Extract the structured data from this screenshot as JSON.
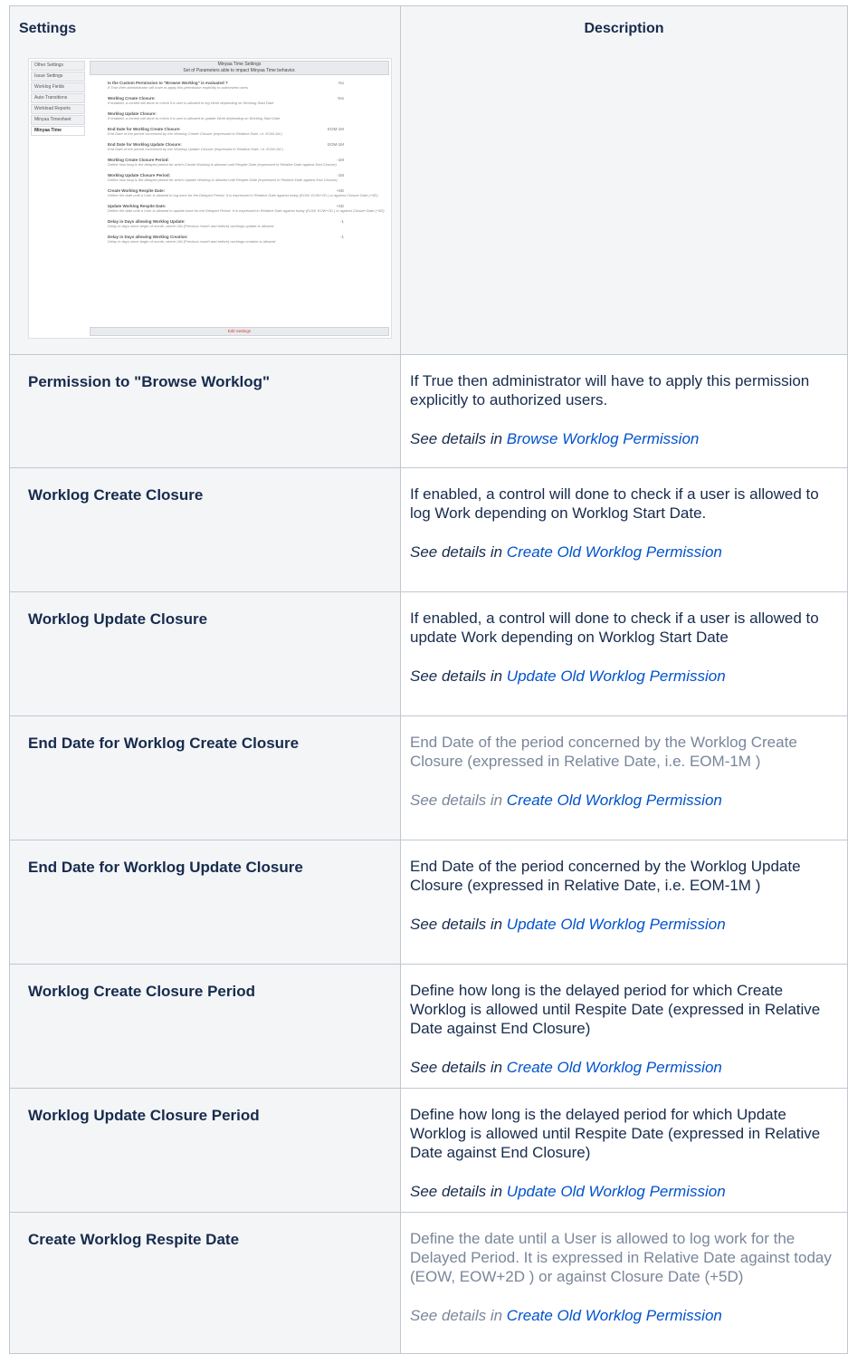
{
  "headers": {
    "settings": "Settings",
    "description": "Description"
  },
  "screenshot": {
    "sidebar": [
      "Other Settings",
      "Issue Settings",
      "Worklog Fields",
      "Auto-Transitions",
      "Workload Reports",
      "Minyaa Timesheet",
      "Minyaa Time"
    ],
    "active_index": 6,
    "title": "Minyaa Time Settings",
    "subtitle": "Set of Parameters able to impact Minyaa Time behavior.",
    "rows": [
      {
        "label": "Is the Custom Permission to \"Browse Worklog\" is evaluated ?",
        "hint": "If True then administrator will have to apply this permission explicitly to authorized users",
        "value": "No"
      },
      {
        "label": "Worklog Create Closure:",
        "hint": "If enabled, a control will done to check if a user is allowed to log Work depending on Worklog Start Date",
        "value": "Yes"
      },
      {
        "label": "Worklog Update Closure:",
        "hint": "If enabled, a control will done to check if a user is allowed to update Work depending on Worklog Start Date",
        "value": ""
      },
      {
        "label": "End Date for Worklog Create Closure:",
        "hint": "End Date of the period concerned by the Worklog Create Closure (expressed in Relative Date, i.e. EOM-1M )",
        "value": "EOM-1M"
      },
      {
        "label": "End Date for Worklog Update Closure:",
        "hint": "End Date of the period concerned by the Worklog Update Closure (expressed in Relative Date, i.e. EOM-1M )",
        "value": "EOM-1M"
      },
      {
        "label": "Worklog Create Closure Period:",
        "hint": "Define how long is the delayed period for which Create Worklog is allowed until Respite Date (expressed in Relative Date against End Closure)",
        "value": "-1M"
      },
      {
        "label": "Worklog Update Closure Period:",
        "hint": "Define how long is the delayed period for which Update Worklog is allowed until Respite Date (expressed in Relative Date against End Closure)",
        "value": "-1M"
      },
      {
        "label": "Create Worklog Respite Date:",
        "hint": "Define the date until a User is allowed to log work for the Delayed Period. It is expressed in Relative Date against today (EOW, EOW+2D ) or against Closure Date (+5D)",
        "value": "+5D"
      },
      {
        "label": "Update Worklog Respite Date:",
        "hint": "Define the date until a User is allowed to update work for the Delayed Period. It is expressed in Relative Date against today (EOW, EOW+2D ) or against Closure Date (+5D)",
        "value": "+5D"
      },
      {
        "label": "Delay in Days allowing Worklog Update:",
        "hint": "Delay in days since begin of month, where Old (Previous month and before) worklogs update is allowed",
        "value": "-1"
      },
      {
        "label": "Delay in Days allowing Worklog Creation:",
        "hint": "Delay in days since begin of month, where Old (Previous month and before) worklogs creation is allowed",
        "value": "-1"
      }
    ],
    "edit_button": "Edit Settings"
  },
  "rows": [
    {
      "setting": "Permission to \"Browse Worklog\"",
      "desc": "If True then administrator will have to apply this permission explicitly to authorized users.",
      "see_prefix": "See details in ",
      "link": "Browse Worklog Permission",
      "grey": false
    },
    {
      "setting": "Worklog Create Closure",
      "desc": "If enabled, a control will done to check if a user is allowed to log Work depending on Worklog Start Date.",
      "see_prefix": "See details in ",
      "link": "Create Old Worklog Permission",
      "grey": false
    },
    {
      "setting": "Worklog Update Closure",
      "desc": "If enabled, a control will done to check if a user is allowed to update Work depending on Worklog Start Date",
      "see_prefix": "See details in ",
      "link": "Update Old Worklog Permission",
      "grey": false
    },
    {
      "setting": "End Date for Worklog Create Closure",
      "desc": "End Date of the period concerned by the Worklog Create Closure (expressed in Relative Date, i.e. EOM-1M )",
      "see_prefix": "See details in ",
      "link": "Create Old Worklog Permission",
      "grey": true
    },
    {
      "setting": "End Date for Worklog Update Closure",
      "desc": "End Date of the period concerned by the Worklog Update Closure (expressed in Relative Date, i.e. EOM-1M )",
      "see_prefix": "See details in ",
      "link": "Update Old Worklog Permission",
      "grey": false
    },
    {
      "setting": "Worklog Create Closure Period",
      "desc": "Define how long is the delayed period for which Create Worklog is allowed until Respite Date (expressed in Relative Date against End Closure)",
      "see_prefix": "See details in ",
      "link": "Create Old Worklog Permission",
      "grey": false
    },
    {
      "setting": "Worklog Update Closure Period",
      "desc": "Define how long is the delayed period for which Update Worklog is allowed until Respite Date (expressed in Relative Date against End Closure)",
      "see_prefix": "See details in ",
      "link": "Update Old Worklog Permission",
      "grey": false
    },
    {
      "setting": "Create Worklog Respite Date",
      "desc": "Define the date until a User is allowed to log work for the Delayed Period. It is expressed in Relative Date against today (EOW, EOW+2D ) or against Closure Date (+5D)",
      "see_prefix": "See details in ",
      "link": "Create Old Worklog Permission",
      "grey": true
    }
  ]
}
